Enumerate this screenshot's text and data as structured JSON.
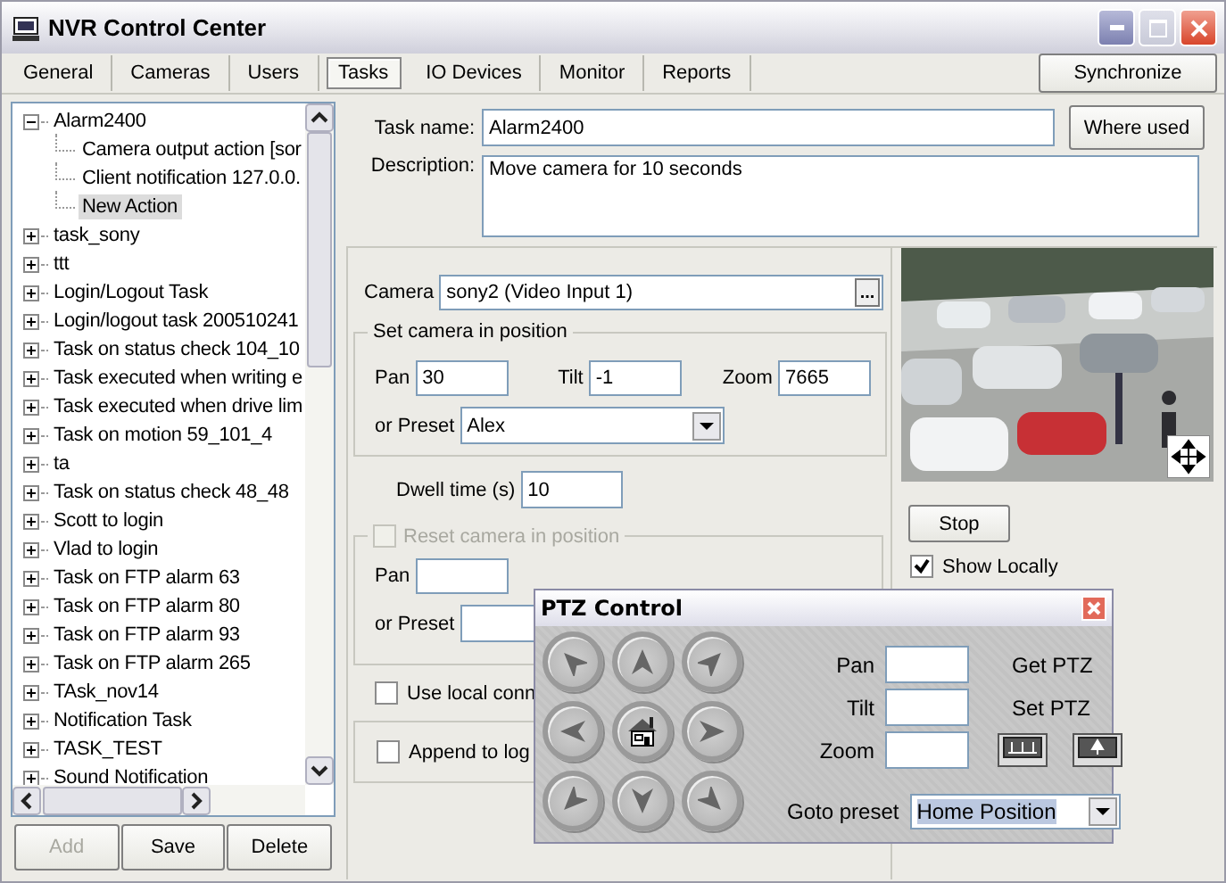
{
  "window": {
    "title": "NVR Control Center"
  },
  "tabs": [
    {
      "label": "General",
      "selected": false
    },
    {
      "label": "Cameras",
      "selected": false
    },
    {
      "label": "Users",
      "selected": false
    },
    {
      "label": "Tasks",
      "selected": true
    },
    {
      "label": "IO Devices",
      "selected": false
    },
    {
      "label": "Monitor",
      "selected": false
    },
    {
      "label": "Reports",
      "selected": false
    }
  ],
  "sync_button": "Synchronize",
  "tree": {
    "items": [
      {
        "label": "Alarm2400",
        "expanded": true,
        "selected": false,
        "children": [
          {
            "label": "Camera output action [sor",
            "selected": false
          },
          {
            "label": "Client notification 127.0.0.",
            "selected": false
          },
          {
            "label": "New Action",
            "selected": true
          }
        ]
      },
      {
        "label": "task_sony",
        "expanded": false,
        "selected": false
      },
      {
        "label": "ttt",
        "expanded": false,
        "selected": false
      },
      {
        "label": "Login/Logout Task",
        "expanded": false,
        "selected": false
      },
      {
        "label": "Login/logout task 200510241",
        "expanded": false,
        "selected": false
      },
      {
        "label": "Task on status check 104_10",
        "expanded": false,
        "selected": false
      },
      {
        "label": "Task executed when writing e",
        "expanded": false,
        "selected": false
      },
      {
        "label": "Task executed when drive lim",
        "expanded": false,
        "selected": false
      },
      {
        "label": "Task on motion 59_101_4",
        "expanded": false,
        "selected": false
      },
      {
        "label": "ta",
        "expanded": false,
        "selected": false
      },
      {
        "label": "Task on status check 48_48",
        "expanded": false,
        "selected": false
      },
      {
        "label": "Scott to login",
        "expanded": false,
        "selected": false
      },
      {
        "label": "Vlad to login",
        "expanded": false,
        "selected": false
      },
      {
        "label": "Task on FTP alarm 63",
        "expanded": false,
        "selected": false
      },
      {
        "label": "Task on FTP alarm 80",
        "expanded": false,
        "selected": false
      },
      {
        "label": "Task on FTP alarm 93",
        "expanded": false,
        "selected": false
      },
      {
        "label": "Task on FTP alarm 265",
        "expanded": false,
        "selected": false
      },
      {
        "label": "TAsk_nov14",
        "expanded": false,
        "selected": false
      },
      {
        "label": "Notification Task",
        "expanded": false,
        "selected": false
      },
      {
        "label": "TASK_TEST",
        "expanded": false,
        "selected": false
      },
      {
        "label": "Sound Notification",
        "expanded": false,
        "selected": false
      }
    ]
  },
  "tree_buttons": [
    {
      "label": "Add",
      "disabled": true
    },
    {
      "label": "Save",
      "disabled": false
    },
    {
      "label": "Delete",
      "disabled": false
    }
  ],
  "task": {
    "name_label": "Task name:",
    "name": "Alarm2400",
    "where_used": "Where used",
    "description_label": "Description:",
    "description": "Move camera for 10 seconds"
  },
  "action": {
    "camera_label": "Camera",
    "camera": "sony2 (Video Input 1)",
    "browse": "...",
    "position_group": {
      "title": "Set camera in position",
      "pan_label": "Pan",
      "pan": "30",
      "tilt_label": "Tilt",
      "tilt": "-1",
      "zoom_label": "Zoom",
      "zoom": "7665",
      "preset_label": "or Preset",
      "preset": "Alex"
    },
    "dwell_label": "Dwell time (s)",
    "dwell": "10",
    "reset_group": {
      "label": "Reset camera in position",
      "checked": false,
      "disabled": true,
      "pan_label": "Pan",
      "preset_label": "or Preset"
    },
    "local_connection": {
      "label": "Use local conn",
      "checked": false
    },
    "append_log": {
      "label": "Append to log",
      "checked": false
    },
    "stop_button": "Stop",
    "show_locally": {
      "label": "Show Locally",
      "checked": true
    }
  },
  "ptz": {
    "title": "PTZ Control",
    "pan_label": "Pan",
    "tilt_label": "Tilt",
    "zoom_label": "Zoom",
    "get_label": "Get PTZ",
    "set_label": "Set PTZ",
    "preset_label": "Goto preset",
    "preset": "Home Position"
  }
}
